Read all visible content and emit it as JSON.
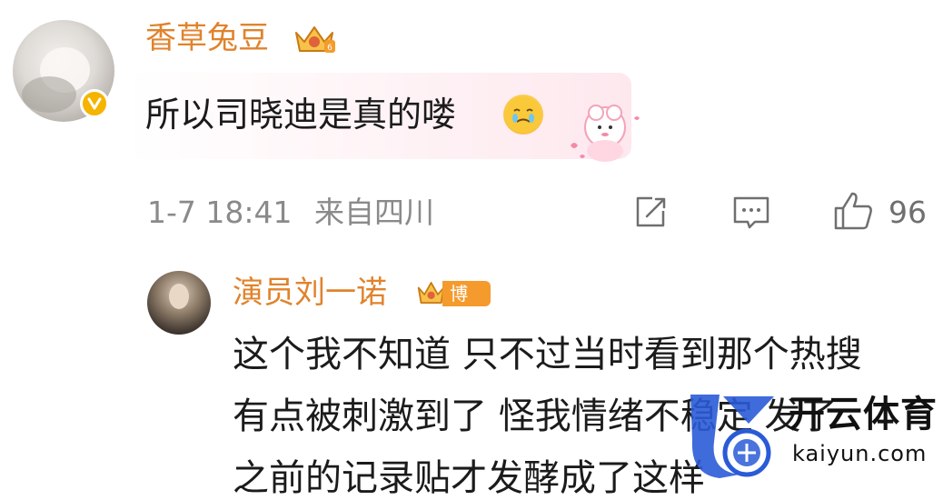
{
  "comment": {
    "username": "香草兔豆",
    "text": "所以司晓迪是真的喽",
    "timestamp": "1-7 18:41",
    "location": "来自四川",
    "like_count": "96",
    "icons": {
      "crown": "crown-badge-icon",
      "verified": "verified-v-icon",
      "emoji": "crying-face-emoji",
      "sticker": "sheep-sticker",
      "share": "share-icon",
      "reply": "comment-icon",
      "like": "thumbs-up-icon"
    }
  },
  "reply": {
    "username": "演员刘一诺",
    "host_label": "博主",
    "lines": [
      "这个我不知道 只不过当时看到那个热搜",
      "有点被刺激到了 怪我情绪不稳定 发了",
      "之前的记录贴才发酵成了这样"
    ]
  },
  "watermark": {
    "title": "开云体育",
    "url": "kaiyun.com"
  },
  "colors": {
    "username": "#e0832c",
    "meta": "#8a8a8a",
    "badge": "#f5b400",
    "watermark_blue": "#2a5bd7"
  }
}
